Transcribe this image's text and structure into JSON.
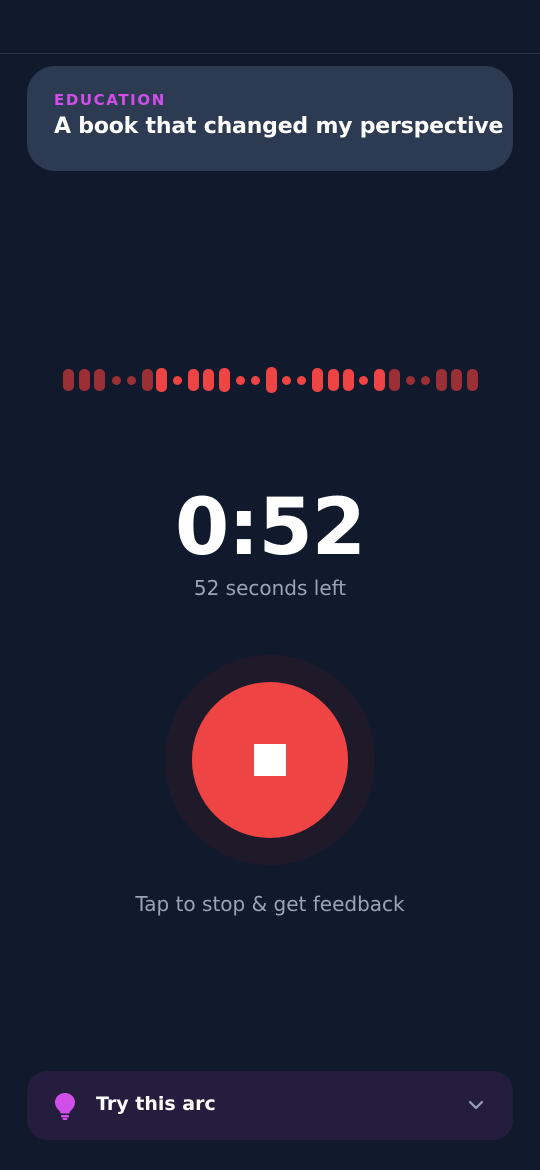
{
  "prompt": {
    "category": "EDUCATION",
    "text": "A book that changed my perspective"
  },
  "timer": {
    "display": "0:52",
    "subtitle": "52 seconds left"
  },
  "recording": {
    "hint": "Tap to stop & get feedback",
    "state": "recording"
  },
  "arc_panel": {
    "label": "Try this arc",
    "icon": "lightbulb-icon",
    "toggle_icon": "chevron-down-icon"
  },
  "colors": {
    "background": "#111a2c",
    "card": "#2c3a52",
    "accent_purple": "#d04fe8",
    "record_red": "#ef4444",
    "wave_dim": "#9b2f36",
    "wave_bright": "#ef4444",
    "muted_text": "#9aa4b8"
  }
}
